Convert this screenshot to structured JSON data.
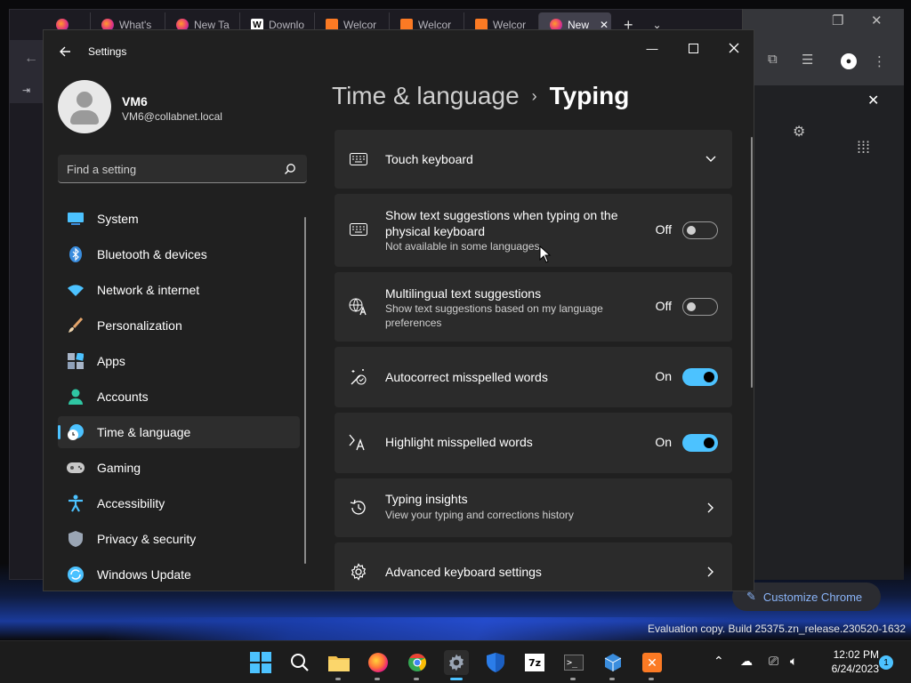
{
  "background": {
    "firefox_tabs": [
      {
        "label": "What's",
        "icon": "firefox-icon"
      },
      {
        "label": "New Ta",
        "icon": "firefox-icon"
      },
      {
        "label": "Downlo",
        "icon": "wikipedia-icon"
      },
      {
        "label": "Welcor",
        "icon": "xampp-icon"
      },
      {
        "label": "Welcor",
        "icon": "xampp-icon"
      },
      {
        "label": "Welcor",
        "icon": "xampp-icon"
      },
      {
        "label": "New",
        "icon": "firefox-icon"
      }
    ],
    "customize_chrome": "Customize Chrome"
  },
  "window": {
    "title": "Settings"
  },
  "profile": {
    "name": "VM6",
    "email": "VM6@collabnet.local"
  },
  "search": {
    "placeholder": "Find a setting"
  },
  "nav": {
    "items": [
      {
        "label": "System",
        "icon": "system-icon",
        "color": "#4cc2ff"
      },
      {
        "label": "Bluetooth & devices",
        "icon": "bluetooth-icon",
        "color": "#3a8dde"
      },
      {
        "label": "Network & internet",
        "icon": "wifi-icon",
        "color": "#4cc2ff"
      },
      {
        "label": "Personalization",
        "icon": "brush-icon",
        "color": "#e3a46a"
      },
      {
        "label": "Apps",
        "icon": "apps-icon",
        "color": "#a8b5c8"
      },
      {
        "label": "Accounts",
        "icon": "accounts-icon",
        "color": "#2fc6a3"
      },
      {
        "label": "Time & language",
        "icon": "time-language-icon",
        "color": "#4cc2ff",
        "selected": true
      },
      {
        "label": "Gaming",
        "icon": "gaming-icon",
        "color": "#c8c8c8"
      },
      {
        "label": "Accessibility",
        "icon": "accessibility-icon",
        "color": "#4cc2ff"
      },
      {
        "label": "Privacy & security",
        "icon": "shield-icon",
        "color": "#9aa5b4"
      },
      {
        "label": "Windows Update",
        "icon": "update-icon",
        "color": "#4cc2ff"
      }
    ]
  },
  "breadcrumb": {
    "parent": "Time & language",
    "separator": "›",
    "current": "Typing"
  },
  "cards": {
    "touch_keyboard": {
      "title": "Touch keyboard"
    },
    "text_suggestions": {
      "title_line1": "Show text suggestions when typing on the",
      "title_line2": "physical keyboard",
      "subtitle": "Not available in some languages",
      "state": "Off"
    },
    "multilingual": {
      "title": "Multilingual text suggestions",
      "subtitle_line1": "Show text suggestions based on my language",
      "subtitle_line2": "preferences",
      "state": "Off"
    },
    "autocorrect": {
      "title": "Autocorrect misspelled words",
      "state": "On"
    },
    "highlight": {
      "title": "Highlight misspelled words",
      "state": "On"
    },
    "insights": {
      "title": "Typing insights",
      "subtitle": "View your typing and corrections history"
    },
    "advanced": {
      "title": "Advanced keyboard settings"
    }
  },
  "watermark": "Evaluation copy. Build 25375.zn_release.230520-1632",
  "taskbar": {
    "time": "12:02 PM",
    "date": "6/24/2023",
    "notifications": "1"
  },
  "colors": {
    "accent": "#4cc2ff",
    "window_bg": "#202020",
    "card_bg": "#2b2b2b"
  }
}
